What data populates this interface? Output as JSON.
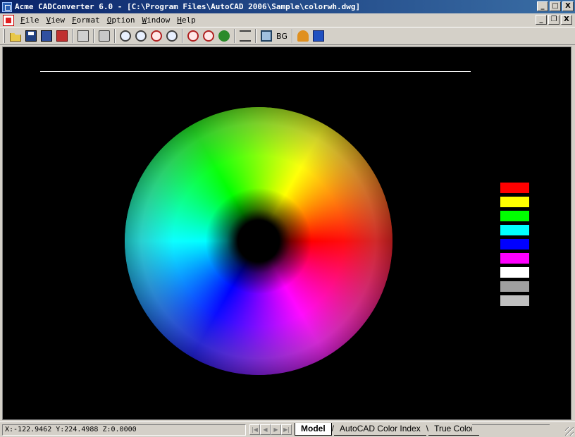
{
  "window": {
    "title": "Acme CADConverter 6.0 - [C:\\Program Files\\AutoCAD 2006\\Sample\\colorwh.dwg]",
    "minimize": "_",
    "maximize": "□",
    "close": "X",
    "restore": "❐"
  },
  "menu": {
    "items": [
      "File",
      "View",
      "Format",
      "Option",
      "Window",
      "Help"
    ]
  },
  "toolbar": {
    "bg_label": "BG",
    "icons": [
      "open-icon",
      "save-icon",
      "save-all-icon",
      "export-icon",
      "batch-icon",
      "print-icon",
      "zoom-out-icon",
      "zoom-in-icon",
      "zoom-window-icon",
      "zoom-realtime-icon",
      "zoom-extents-icon",
      "zoom-previous-icon",
      "view-icon",
      "layers-icon",
      "frame-icon",
      "bg-icon",
      "user-icon",
      "about-icon"
    ]
  },
  "drawing": {
    "background": "#000000",
    "line_color": "#ffffff",
    "swatch_colors": [
      "#ff0000",
      "#ffff00",
      "#00ff00",
      "#00ffff",
      "#0000ff",
      "#ff00ff",
      "#ffffff",
      "#a0a0a0",
      "#c0c0c0"
    ]
  },
  "status": {
    "coords": "X:-122.9462 Y:224.4988 Z:0.0000"
  },
  "layout_tabs": {
    "tabs": [
      "Model",
      "AutoCAD Color Index",
      "True Color"
    ],
    "active": "Model"
  }
}
